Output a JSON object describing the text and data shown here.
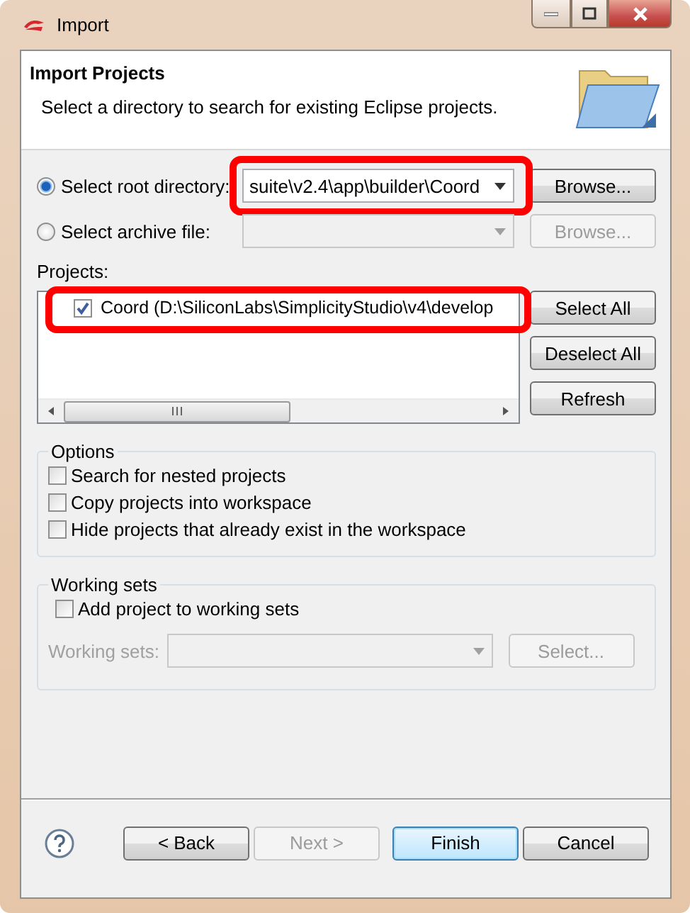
{
  "window": {
    "title": "Import"
  },
  "header": {
    "title": "Import Projects",
    "description": "Select a directory to search for existing Eclipse projects."
  },
  "sources": [
    {
      "label": "Select root directory:",
      "selected": true,
      "value": "suite\\v2.4\\app\\builder\\Coord",
      "disabled": false,
      "highlighted": true,
      "button": "Browse..."
    },
    {
      "label": "Select archive file:",
      "selected": false,
      "disabled": true,
      "button": "Browse..."
    }
  ],
  "projects": {
    "label": "Projects:",
    "items": [
      {
        "label": "Coord (D:\\SiliconLabs\\SimplicityStudio\\v4\\develop",
        "checked": true,
        "highlighted": true
      }
    ],
    "buttons": [
      "Select All",
      "Deselect All",
      "Refresh"
    ]
  },
  "options": {
    "title": "Options",
    "items": [
      {
        "label": "Search for nested projects",
        "checked": false
      },
      {
        "label": "Copy projects into workspace",
        "checked": false
      },
      {
        "label": "Hide projects that already exist in the workspace",
        "checked": false
      }
    ]
  },
  "working_sets": {
    "title": "Working sets",
    "checkbox": {
      "label": "Add project to working sets",
      "checked": false
    },
    "field_label": "Working sets:",
    "button": "Select...",
    "disabled": true
  },
  "footer": {
    "buttons": [
      {
        "label": "< Back",
        "disabled": false,
        "default": false
      },
      {
        "label": "Next >",
        "disabled": true,
        "default": false
      },
      {
        "label": "Finish",
        "disabled": false,
        "default": true
      },
      {
        "label": "Cancel",
        "disabled": false,
        "default": false
      }
    ]
  }
}
